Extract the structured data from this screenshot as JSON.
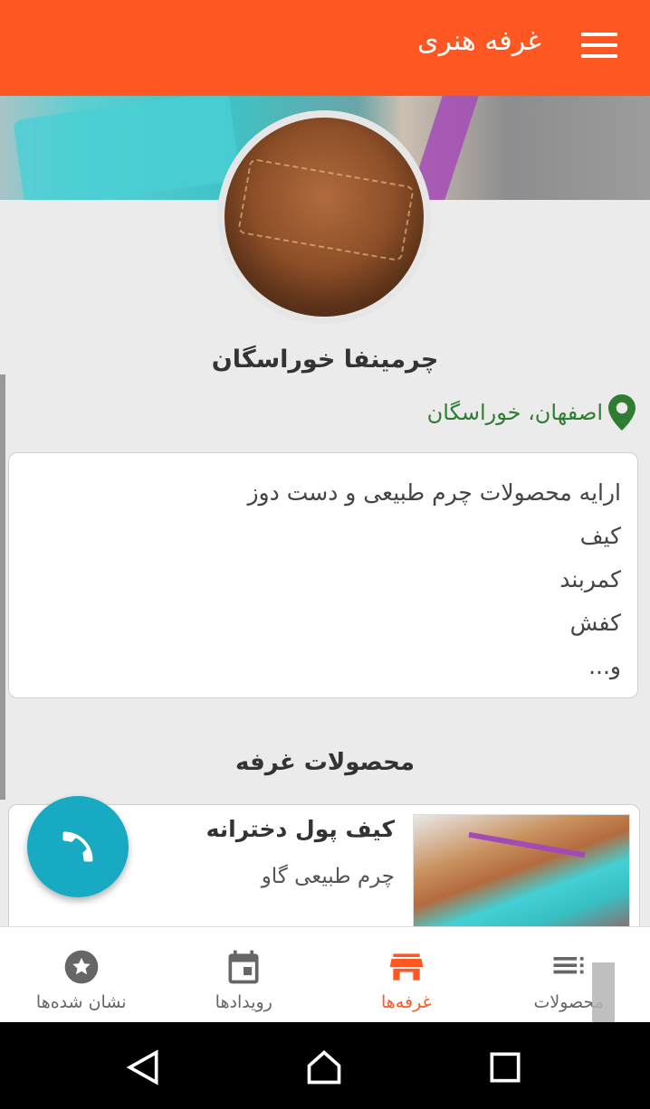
{
  "appbar": {
    "title": "غرفه هنری",
    "menu_icon": "menu-icon"
  },
  "shop": {
    "name": "چرمینفا خوراسگان",
    "location": "اصفهان، خوراسگان",
    "description_lines": [
      "ارایه محصولات چرم طبیعی و دست دوز",
      "کیف",
      "کمربند",
      "کفش",
      "و..."
    ]
  },
  "section": {
    "title": "محصولات غرفه"
  },
  "products": [
    {
      "name": "کیف پول دخترانه",
      "description": "چرم طبیعی گاو"
    }
  ],
  "bottom_nav": [
    {
      "label": "محصولات",
      "icon": "list-icon",
      "active": false
    },
    {
      "label": "غرفه‌ها",
      "icon": "store-icon",
      "active": true
    },
    {
      "label": "رویدادها",
      "icon": "calendar-icon",
      "active": false
    },
    {
      "label": "نشان شده‌ها",
      "icon": "star-icon",
      "active": false
    }
  ],
  "colors": {
    "primary": "#ff5722",
    "fab": "#18a9c3",
    "location": "#2e7d32"
  }
}
